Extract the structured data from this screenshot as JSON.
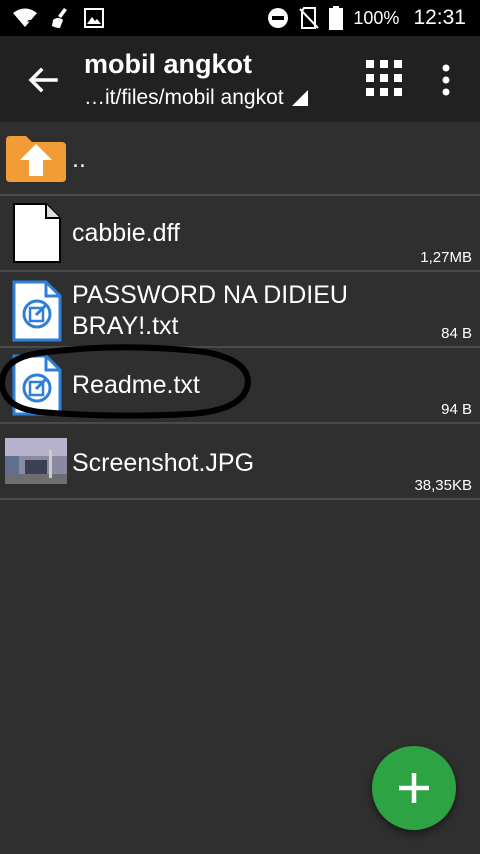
{
  "status_bar": {
    "battery_percent": "100%",
    "time": "12:31",
    "icons": [
      "wifi-no-internet-icon",
      "cleaner-icon",
      "image-icon",
      "do-not-disturb-icon",
      "no-sim-icon",
      "battery-icon"
    ]
  },
  "toolbar": {
    "title": "mobil angkot",
    "path": "…it/files/mobil angkot"
  },
  "files": [
    {
      "name": "..",
      "size": "",
      "icon": "folder-up-icon"
    },
    {
      "name": "cabbie.dff",
      "size": "1,27MB",
      "icon": "file-icon"
    },
    {
      "name": "PASSWORD NA DIDIEU BRAY!.txt",
      "size": "84 B",
      "icon": "text-file-icon"
    },
    {
      "name": "Readme.txt",
      "size": "94 B",
      "icon": "text-file-icon"
    },
    {
      "name": "Screenshot.JPG",
      "size": "38,35KB",
      "icon": "image-thumbnail"
    }
  ],
  "colors": {
    "background": "#2f2f2f",
    "toolbar": "#212121",
    "fab": "#2ea343",
    "folder": "#f29c38",
    "text_icon": "#2f7fd8"
  }
}
